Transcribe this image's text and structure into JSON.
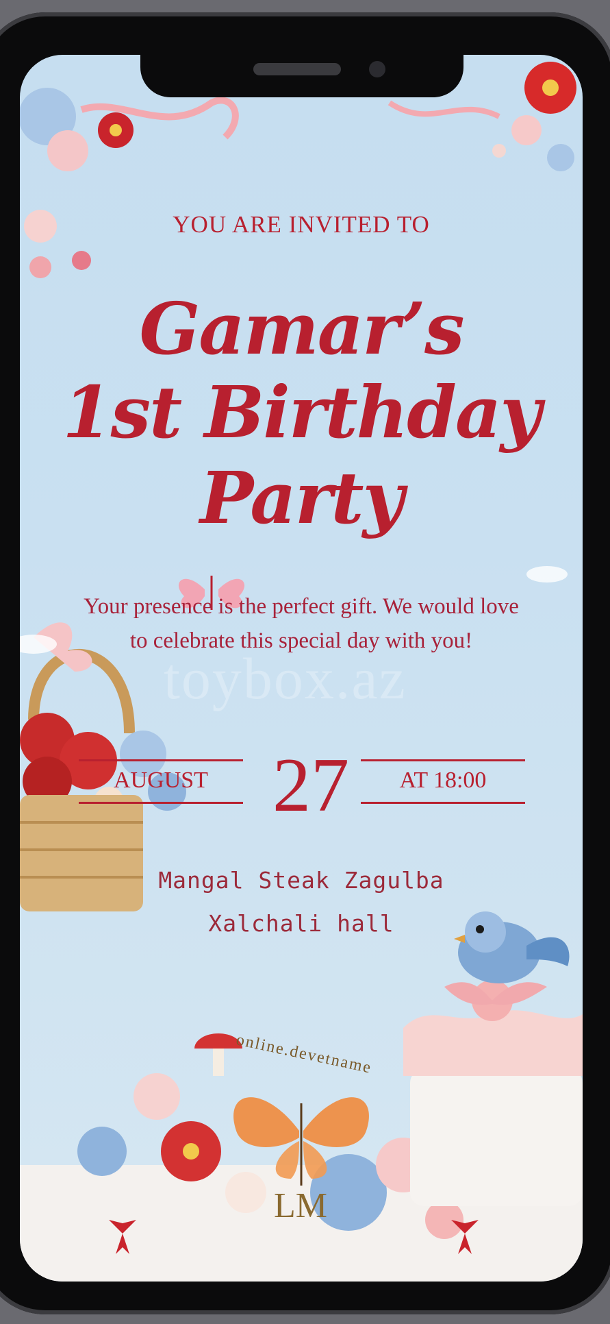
{
  "invitation": {
    "intro": "YOU ARE INVITED TO",
    "title_line1": "Gamar’s",
    "title_line2": "1st Birthday",
    "title_line3": "Party",
    "message": "Your presence is the perfect gift. We would love to celebrate this special day with you!",
    "month": "AUGUST",
    "day": "27",
    "time": "AT 18:00",
    "venue_line1": "Mangal Steak Zagulba",
    "venue_line2": "Xalchali hall"
  },
  "watermark": {
    "text": "toybox.az"
  },
  "logo": {
    "arc_text": "online.devetname",
    "monogram": "LM"
  },
  "colors": {
    "accent": "#b8202f",
    "background": "#c8dff0",
    "butterfly": "#f08a3c"
  }
}
